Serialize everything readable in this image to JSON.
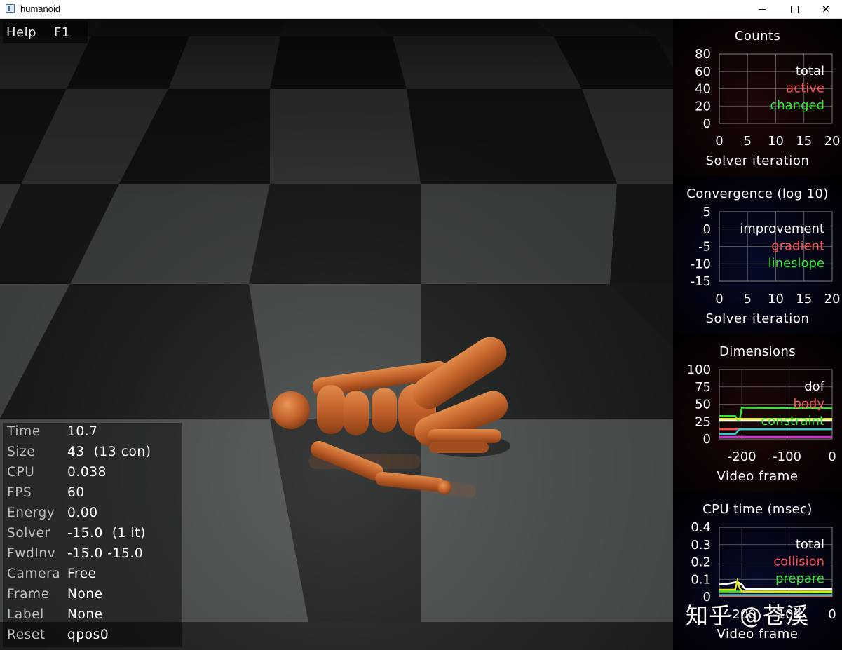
{
  "window": {
    "title": "humanoid"
  },
  "help": {
    "label": "Help",
    "key": "F1"
  },
  "info": [
    {
      "label": "Time",
      "value": "10.7"
    },
    {
      "label": "Size",
      "value": "43  (13 con)"
    },
    {
      "label": "CPU",
      "value": "0.038"
    },
    {
      "label": "FPS",
      "value": "60"
    },
    {
      "label": "Energy",
      "value": "0.00"
    },
    {
      "label": "Solver",
      "value": "-15.0  (1 it)"
    },
    {
      "label": "FwdInv",
      "value": "-15.0 -15.0"
    },
    {
      "label": "Camera",
      "value": "Free"
    },
    {
      "label": "Frame",
      "value": "None"
    },
    {
      "label": "Label",
      "value": "None"
    },
    {
      "label": "Reset",
      "value": "qpos0"
    }
  ],
  "colors": {
    "counts_bg": "#1c0707",
    "convergence_bg": "#070a26",
    "dimensions_bg": "#1c0707",
    "cputime_bg": "#070a26",
    "legend_white": "#ffffff",
    "legend_red": "#ff4d4d",
    "legend_green": "#33e633",
    "body_color": "#c96a2c"
  },
  "chart_data": [
    {
      "type": "line",
      "title": "Counts",
      "xlabel": "Solver iteration",
      "x_ticks": [
        "0",
        "5",
        "10",
        "15",
        "20"
      ],
      "y_ticks": [
        "80",
        "60",
        "40",
        "20",
        "0"
      ],
      "xlim": [
        0,
        20
      ],
      "ylim": [
        0,
        80
      ],
      "grid": true,
      "legend_position": "top-right",
      "series": [
        {
          "name": "total",
          "color": "#ffffff",
          "values": []
        },
        {
          "name": "active",
          "color": "#ff4d4d",
          "values": []
        },
        {
          "name": "changed",
          "color": "#33e633",
          "values": []
        }
      ]
    },
    {
      "type": "line",
      "title": "Convergence (log 10)",
      "xlabel": "Solver iteration",
      "x_ticks": [
        "0",
        "5",
        "10",
        "15",
        "20"
      ],
      "y_ticks": [
        "5",
        "0",
        "-5",
        "-10",
        "-15"
      ],
      "xlim": [
        0,
        20
      ],
      "ylim": [
        -15,
        5
      ],
      "grid": true,
      "legend_position": "top-right",
      "series": [
        {
          "name": "improvement",
          "color": "#ffffff",
          "values": []
        },
        {
          "name": "gradient",
          "color": "#ff4d4d",
          "values": []
        },
        {
          "name": "lineslope",
          "color": "#33e633",
          "values": []
        }
      ]
    },
    {
      "type": "line",
      "title": "Dimensions",
      "xlabel": "Video frame",
      "x_ticks": [
        "-200",
        "-100",
        "0"
      ],
      "y_ticks": [
        "100",
        "75",
        "50",
        "25",
        "0"
      ],
      "xlim": [
        -250,
        0
      ],
      "ylim": [
        0,
        100
      ],
      "grid": true,
      "legend_position": "top-right",
      "series": [
        {
          "name": "dof",
          "color": "#ffffff",
          "x": [
            -250,
            0
          ],
          "values": [
            27,
            27
          ]
        },
        {
          "name": "body",
          "color": "#ff4d4d",
          "x": [
            -250,
            0
          ],
          "values": [
            14,
            14
          ]
        },
        {
          "name": "constraint",
          "color": "#33e633",
          "x": [
            -250,
            -215,
            -210,
            -205,
            -200,
            -195,
            0
          ],
          "values": [
            33,
            33,
            28,
            28,
            45,
            45,
            44
          ]
        },
        {
          "color": "#e6e61a",
          "x": [
            -250,
            0
          ],
          "values": [
            29,
            29
          ]
        },
        {
          "color": "#33cccc",
          "x": [
            -250,
            -215,
            -205,
            0
          ],
          "values": [
            7,
            7,
            14,
            14
          ]
        },
        {
          "color": "#cc33cc",
          "x": [
            -250,
            0
          ],
          "values": [
            3,
            3
          ]
        }
      ]
    },
    {
      "type": "line",
      "title": "CPU time (msec)",
      "xlabel": "Video frame",
      "x_ticks": [
        "-200",
        "-100",
        "0"
      ],
      "y_ticks": [
        "0.4",
        "0.3",
        "0.2",
        "0.1",
        "0"
      ],
      "xlim": [
        -250,
        0
      ],
      "ylim": [
        0,
        0.4
      ],
      "grid": true,
      "legend_position": "top-right",
      "series": [
        {
          "name": "total",
          "color": "#ffffff",
          "x": [
            -250,
            -230,
            -220,
            -210,
            -200,
            -195,
            -190,
            0
          ],
          "values": [
            0.07,
            0.075,
            0.08,
            0.085,
            0.07,
            0.05,
            0.045,
            0.045
          ]
        },
        {
          "name": "collision",
          "color": "#ff4d4d",
          "x": [
            -250,
            0
          ],
          "values": [
            0.005,
            0.005
          ]
        },
        {
          "name": "prepare",
          "color": "#33e633",
          "x": [
            -250,
            -200,
            0
          ],
          "values": [
            0.03,
            0.03,
            0.025
          ]
        },
        {
          "color": "#e6e61a",
          "x": [
            -250,
            -215,
            -210,
            -205,
            -200,
            0
          ],
          "values": [
            0.04,
            0.04,
            0.09,
            0.05,
            0.03,
            0.03
          ]
        },
        {
          "color": "#33cccc",
          "x": [
            -250,
            0
          ],
          "values": [
            0.01,
            0.01
          ]
        }
      ]
    }
  ],
  "watermark": "知乎 @苍溪"
}
